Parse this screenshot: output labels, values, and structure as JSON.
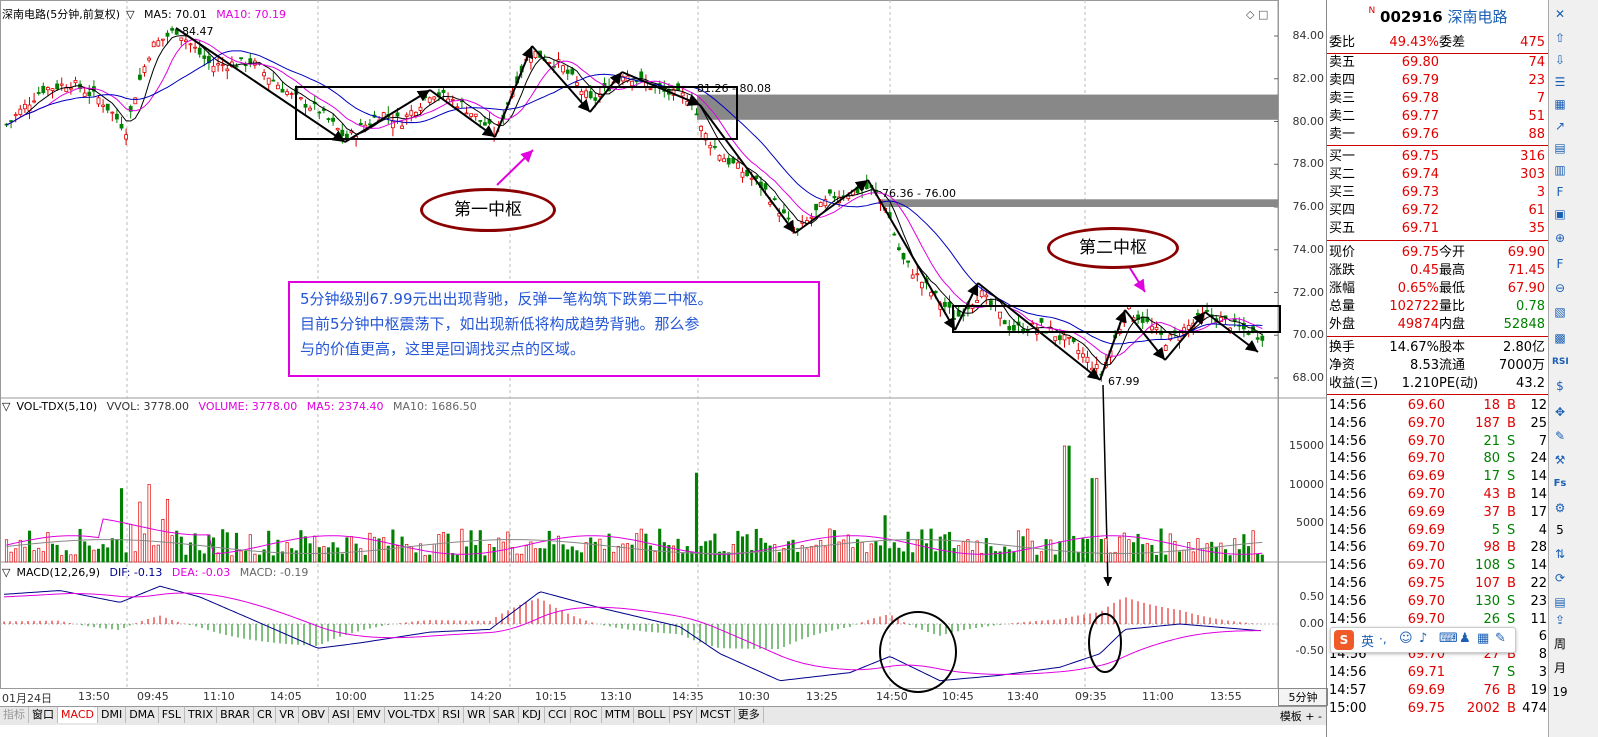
{
  "chart_header": {
    "title": "深南电路(5分钟,前复权)",
    "ma5": "MA5: 70.01",
    "ma10": "MA10: 70.19"
  },
  "price_axis": [
    "84.00",
    "82.00",
    "80.00",
    "78.00",
    "76.00",
    "74.00",
    "72.00",
    "70.00",
    "68.00"
  ],
  "annotations": {
    "high_label": "84.47",
    "low_label": "67.99",
    "zone1_label": "81.26 - 80.08",
    "zone2_label": "76.36 - 76.00",
    "pivot1": "第一中枢",
    "pivot2": "第二中枢",
    "callout_line1": "5分钟级别67.99元出出现背驰，反弹一笔构筑下跌第二中枢。",
    "callout_line2": "目前5分钟中枢震荡下，如出现新低将构成趋势背驰。那么参",
    "callout_line3": "与的价值更高，这里是回调找买点的区域。"
  },
  "vol_header": {
    "name": "VOL-TDX(5,10)",
    "vvol": "VVOL: 3778.00",
    "volume": "VOLUME: 3778.00",
    "ma5": "MA5: 2374.40",
    "ma10": "MA10: 1686.50"
  },
  "vol_axis": [
    "15000",
    "10000",
    "5000"
  ],
  "macd_header": {
    "name": "MACD(12,26,9)",
    "dif": "DIF: -0.13",
    "dea": "DEA: -0.03",
    "macd": "MACD: -0.19"
  },
  "macd_axis": [
    "0.50",
    "0.00",
    "-0.50"
  ],
  "time_axis": [
    "01月24日",
    "13:50",
    "09:45",
    "11:10",
    "14:05",
    "10:00",
    "11:25",
    "14:20",
    "10:15",
    "13:10",
    "14:35",
    "10:30",
    "13:25",
    "14:50",
    "10:45",
    "13:40",
    "09:35",
    "11:00",
    "13:55"
  ],
  "period_label": "5分钟",
  "tabs": [
    "指标",
    "窗口",
    "MACD",
    "DMI",
    "DMA",
    "FSL",
    "TRIX",
    "BRAR",
    "CR",
    "VR",
    "OBV",
    "ASI",
    "EMV",
    "VOL-TDX",
    "RSI",
    "WR",
    "SAR",
    "KDJ",
    "CCI",
    "ROC",
    "MTM",
    "BOLL",
    "PSY",
    "MCST",
    "更多"
  ],
  "active_tab": "MACD",
  "bottom_right": [
    "模板",
    "+",
    "-"
  ],
  "quote": {
    "code": "002916",
    "name": "深南电路",
    "webi_label": "委比",
    "webi_value": "49.43%",
    "wecha_label": "委差",
    "wecha_value": "475",
    "asks": [
      {
        "label": "卖五",
        "price": "69.80",
        "vol": "74"
      },
      {
        "label": "卖四",
        "price": "69.79",
        "vol": "23"
      },
      {
        "label": "卖三",
        "price": "69.78",
        "vol": "7"
      },
      {
        "label": "卖二",
        "price": "69.77",
        "vol": "51"
      },
      {
        "label": "卖一",
        "price": "69.76",
        "vol": "88"
      }
    ],
    "bids": [
      {
        "label": "买一",
        "price": "69.75",
        "vol": "316"
      },
      {
        "label": "买二",
        "price": "69.74",
        "vol": "303"
      },
      {
        "label": "买三",
        "price": "69.73",
        "vol": "3"
      },
      {
        "label": "买四",
        "price": "69.72",
        "vol": "61"
      },
      {
        "label": "买五",
        "price": "69.71",
        "vol": "35"
      }
    ],
    "stats": [
      {
        "l1": "现价",
        "v1": "69.75",
        "l2": "今开",
        "v2": "69.90"
      },
      {
        "l1": "涨跌",
        "v1": "0.45",
        "l2": "最高",
        "v2": "71.45"
      },
      {
        "l1": "涨幅",
        "v1": "0.65%",
        "l2": "最低",
        "v2": "67.90"
      },
      {
        "l1": "总量",
        "v1": "102722",
        "l2": "量比",
        "v2": "0.78"
      },
      {
        "l1": "外盘",
        "v1": "49874",
        "l2": "内盘",
        "v2": "52848"
      }
    ],
    "stats2": [
      {
        "l1": "换手",
        "v1": "14.67%",
        "l2": "股本",
        "v2": "2.80亿"
      },
      {
        "l1": "净资",
        "v1": "8.53",
        "l2": "流通",
        "v2": "7000万"
      },
      {
        "l1": "收益(三)",
        "v1": "1.210",
        "l2": "PE(动)",
        "v2": "43.2"
      }
    ]
  },
  "ticks": [
    {
      "t": "14:56",
      "p": "69.60",
      "v": "18",
      "bs": "B",
      "n": "12"
    },
    {
      "t": "14:56",
      "p": "69.70",
      "v": "187",
      "bs": "B",
      "n": "25"
    },
    {
      "t": "14:56",
      "p": "69.70",
      "v": "21",
      "bs": "S",
      "n": "7"
    },
    {
      "t": "14:56",
      "p": "69.70",
      "v": "80",
      "bs": "S",
      "n": "24"
    },
    {
      "t": "14:56",
      "p": "69.69",
      "v": "17",
      "bs": "S",
      "n": "14"
    },
    {
      "t": "14:56",
      "p": "69.70",
      "v": "43",
      "bs": "B",
      "n": "14"
    },
    {
      "t": "14:56",
      "p": "69.69",
      "v": "37",
      "bs": "B",
      "n": "17"
    },
    {
      "t": "14:56",
      "p": "69.69",
      "v": "5",
      "bs": "S",
      "n": "4"
    },
    {
      "t": "14:56",
      "p": "69.70",
      "v": "98",
      "bs": "B",
      "n": "28"
    },
    {
      "t": "14:56",
      "p": "69.70",
      "v": "108",
      "bs": "S",
      "n": "14"
    },
    {
      "t": "14:56",
      "p": "69.75",
      "v": "107",
      "bs": "B",
      "n": "22"
    },
    {
      "t": "14:56",
      "p": "69.70",
      "v": "130",
      "bs": "S",
      "n": "23"
    },
    {
      "t": "14:56",
      "p": "69.70",
      "v": "26",
      "bs": "S",
      "n": "11"
    },
    {
      "t": "14:56",
      "p": "69.70",
      "v": "",
      "bs": "",
      "n": "6"
    },
    {
      "t": "14:56",
      "p": "69.70",
      "v": "27",
      "bs": "B",
      "n": "8"
    },
    {
      "t": "14:56",
      "p": "69.71",
      "v": "7",
      "bs": "S",
      "n": "3"
    },
    {
      "t": "14:57",
      "p": "69.69",
      "v": "76",
      "bs": "B",
      "n": "19"
    },
    {
      "t": "15:00",
      "p": "69.75",
      "v": "2002",
      "bs": "B",
      "n": "474"
    }
  ],
  "ime": {
    "logo": "S",
    "lang": "英"
  },
  "toolbar_labels": [
    "RSI",
    "Fs",
    "5",
    "周",
    "月",
    "19"
  ],
  "colors": {
    "up": "#e00000",
    "down": "#008000",
    "ma5": "#000000",
    "ma10": "#e000e0",
    "ma20": "#0000c0"
  }
}
